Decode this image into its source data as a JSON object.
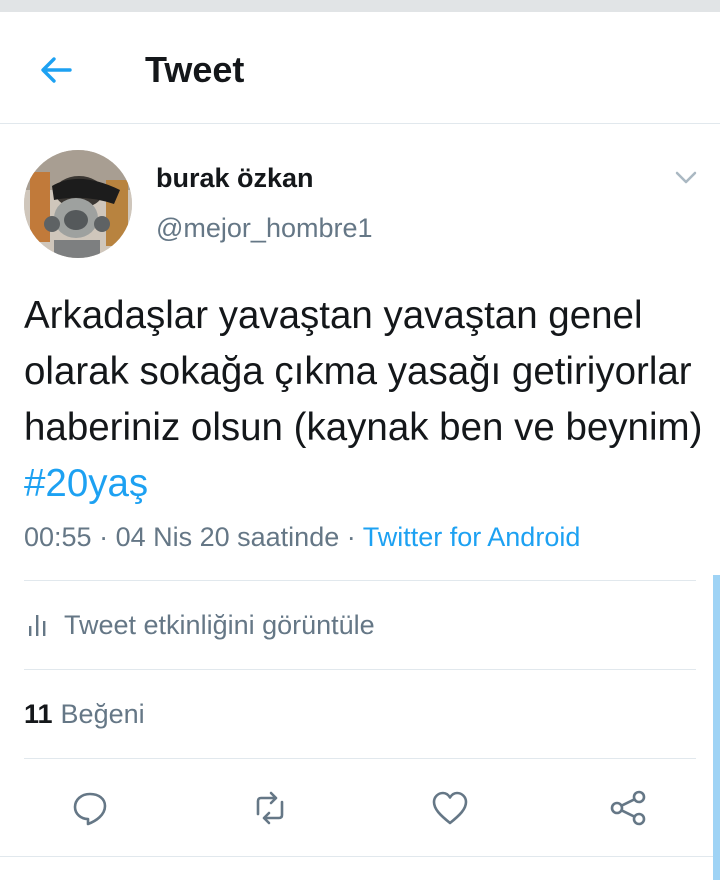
{
  "header": {
    "title": "Tweet",
    "back_icon": "arrow-left-icon"
  },
  "tweet": {
    "author": {
      "name": "burak özkan",
      "handle": "@mejor_hombre1"
    },
    "text": "Arkadaşlar yavaştan yavaştan genel olarak sokağa çıkma yasağı getiriyorlar haberiniz olsun (kaynak ben ve beynim) ",
    "hashtag": "#20yaş",
    "time": "00:55",
    "separator": " · ",
    "date": "04 Nis 20 saatinde",
    "source": "Twitter for Android"
  },
  "activity": {
    "label": "Tweet etkinliğini görüntüle",
    "icon": "bar-chart-icon"
  },
  "likes": {
    "count": "11",
    "label": "Beğeni"
  },
  "actions": [
    "reply-icon",
    "retweet-icon",
    "like-icon",
    "share-icon"
  ],
  "colors": {
    "accent": "#1da1f2",
    "text": "#14171a",
    "secondary": "#657786",
    "divider": "#e1e8ed"
  }
}
